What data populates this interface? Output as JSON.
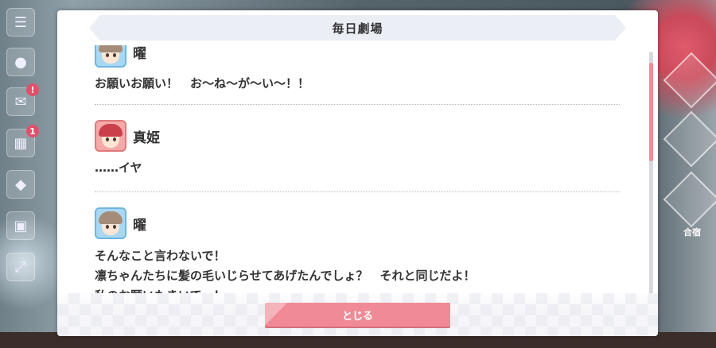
{
  "dialog": {
    "title": "毎日劇場",
    "close_label": "とじる"
  },
  "entries": [
    {
      "speaker": "曜",
      "avatar": "you-avatar",
      "lines": [
        "お願いお願い！　お〜ね〜が〜い〜！！"
      ]
    },
    {
      "speaker": "真姫",
      "avatar": "maki-avatar",
      "lines": [
        "……イヤ"
      ]
    },
    {
      "speaker": "曜",
      "avatar": "you-avatar",
      "lines": [
        "そんなこと言わないで！",
        "凛ちゃんたちに髪の毛いじらせてあげたんでしょ？　それと同じだよ！",
        "私のお願いもきいて〜！"
      ]
    }
  ],
  "background": {
    "left_rail_badges": [
      "!",
      "1"
    ],
    "right_label": "合宿"
  },
  "colors": {
    "accent": "#f08a96",
    "header_bg": "#eceef6",
    "text": "#333333"
  }
}
